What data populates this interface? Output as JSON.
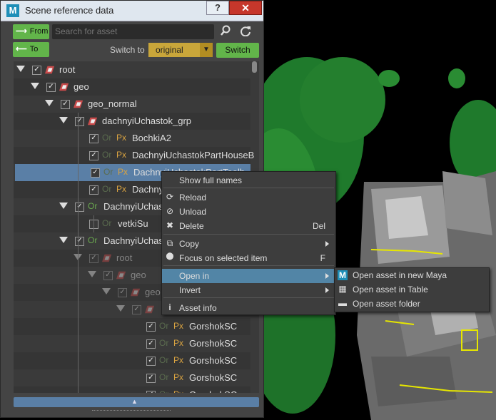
{
  "window": {
    "title": "Scene reference data",
    "app_icon": "M",
    "help_label": "?",
    "close_label": "✕"
  },
  "toolbar": {
    "from_label": "From",
    "to_label": "To",
    "search_placeholder": "Search for asset",
    "switch_to_label": "Switch to",
    "switch_value": "original",
    "switch_button": "Switch"
  },
  "tree": {
    "tag_or": "Or",
    "tag_px": "Px",
    "rows": [
      {
        "label": "root",
        "depth": 0
      },
      {
        "label": "geo",
        "depth": 1
      },
      {
        "label": "geo_normal",
        "depth": 2
      },
      {
        "label": "dachnyiUchastok_grp",
        "depth": 3
      },
      {
        "label": "BochkiA2",
        "depth": 4
      },
      {
        "label": "DachnyiUchastokPartHouseB",
        "depth": 4
      },
      {
        "label": "DachnyiUchastokPartToolb",
        "depth": 4
      },
      {
        "label": "DachnyiUchastokPart",
        "depth": 4
      },
      {
        "label": "DachnyiUchastok",
        "depth": 3
      },
      {
        "label": "vetkiSu",
        "depth": 4
      },
      {
        "label": "DachnyiUchastok",
        "depth": 3
      },
      {
        "label": "root",
        "depth": 4
      },
      {
        "label": "geo",
        "depth": 5
      },
      {
        "label": "geo",
        "depth": 6
      },
      {
        "label": "",
        "depth": 7
      },
      {
        "label": "GorshokSC",
        "depth": 8
      },
      {
        "label": "GorshokSC",
        "depth": 8
      },
      {
        "label": "GorshokSC",
        "depth": 8
      },
      {
        "label": "GorshokSC",
        "depth": 8
      },
      {
        "label": "GorshokSC",
        "depth": 8
      }
    ]
  },
  "context_menu": {
    "items": [
      {
        "label": "Show full names",
        "icon": ""
      },
      {
        "label": "Reload",
        "icon": "reload-icon"
      },
      {
        "label": "Unload",
        "icon": "unload-icon"
      },
      {
        "label": "Delete",
        "icon": "delete-icon",
        "shortcut": "Del"
      },
      {
        "label": "Copy",
        "icon": "copy-icon"
      },
      {
        "label": "Focus on selected item",
        "icon": "location-pin-icon",
        "shortcut": "F"
      },
      {
        "label": "Open in",
        "icon": ""
      },
      {
        "label": "Invert",
        "icon": ""
      },
      {
        "label": "Asset info",
        "icon": "info-icon"
      }
    ]
  },
  "submenu": {
    "items": [
      {
        "label": "Open asset in new Maya",
        "icon": "maya-icon"
      },
      {
        "label": "Open asset in Table",
        "icon": "table-icon"
      },
      {
        "label": "Open asset folder",
        "icon": "folder-icon"
      }
    ]
  },
  "colors": {
    "accent_green": "#62b54a",
    "selection_blue": "#5a7fa6",
    "menu_highlight": "#5285a6",
    "switch_select": "#c9a63a",
    "tag_or": "#6aa84f",
    "tag_px": "#d9a341"
  }
}
